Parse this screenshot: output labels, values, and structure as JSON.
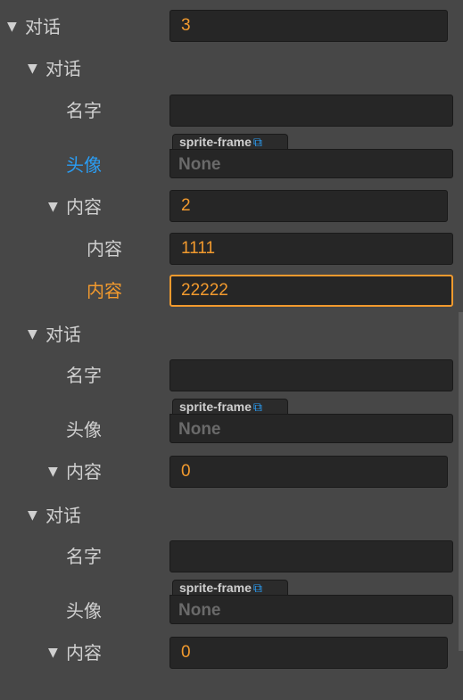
{
  "root": {
    "label": "对话",
    "count": "3"
  },
  "dialogues": [
    {
      "label": "对话",
      "name_label": "名字",
      "name_value": "",
      "avatar_label": "头像",
      "asset_type": "sprite-frame",
      "avatar_value": "None",
      "content_label": "内容",
      "content_count": "2",
      "contents": [
        {
          "label": "内容",
          "value": "1111"
        },
        {
          "label": "内容",
          "value": "22222"
        }
      ]
    },
    {
      "label": "对话",
      "name_label": "名字",
      "name_value": "",
      "avatar_label": "头像",
      "asset_type": "sprite-frame",
      "avatar_value": "None",
      "content_label": "内容",
      "content_count": "0",
      "contents": []
    },
    {
      "label": "对话",
      "name_label": "名字",
      "name_value": "",
      "avatar_label": "头像",
      "asset_type": "sprite-frame",
      "avatar_value": "None",
      "content_label": "内容",
      "content_count": "0",
      "contents": []
    }
  ],
  "icons": {
    "expanded": "triangle-down-icon",
    "external_link": "external-link-icon"
  },
  "colors": {
    "background": "#474747",
    "input": "#262626",
    "value": "#f29a2e",
    "link": "#2a9df4",
    "focus": "#f29a2e"
  }
}
